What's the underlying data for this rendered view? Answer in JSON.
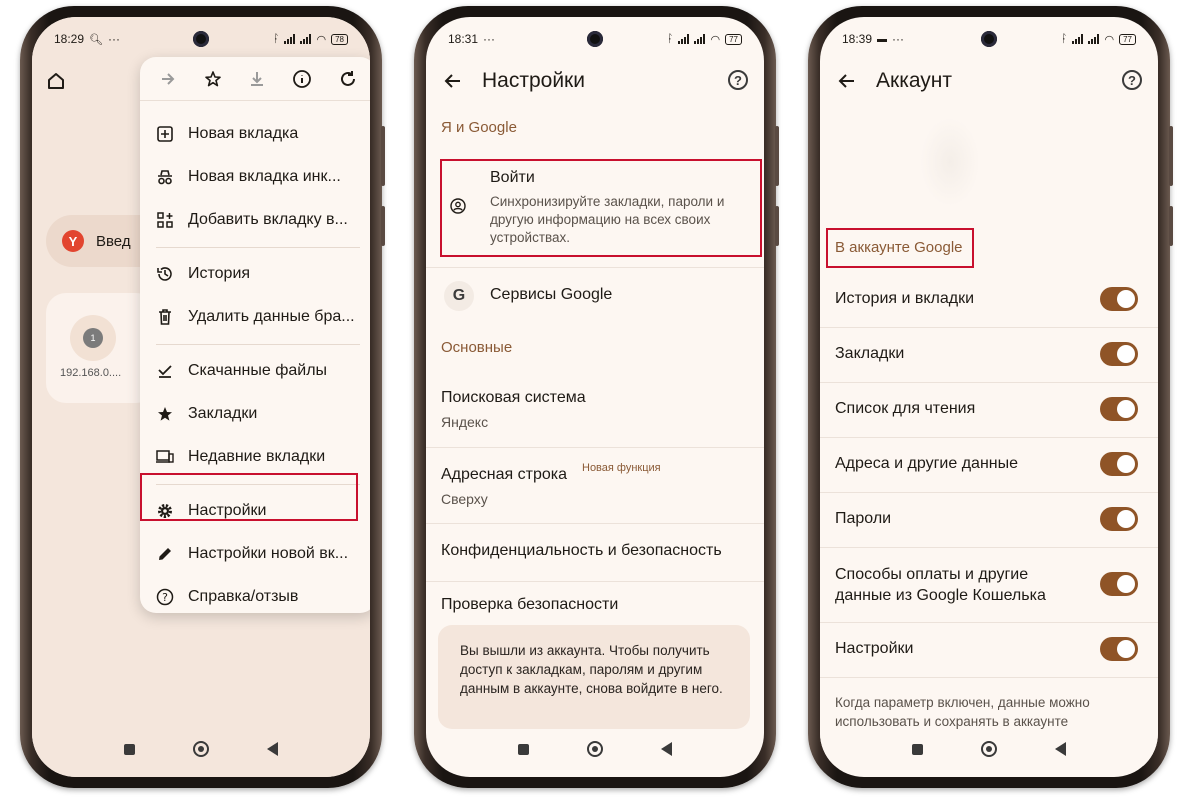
{
  "phone1": {
    "status": {
      "time": "18:29",
      "dots": "···",
      "battery": "78"
    },
    "toolbar_icons": [
      "arrow-forward-icon",
      "star-icon",
      "download-icon",
      "info-icon",
      "refresh-icon"
    ],
    "search_partial": "Введ",
    "tile_label": "192.168.0....",
    "tile_count": "1",
    "menu_items": [
      {
        "label": "Новая вкладка",
        "icon": "new-tab-icon"
      },
      {
        "label": "Новая вкладка инк...",
        "icon": "incognito-icon"
      },
      {
        "label": "Добавить вкладку в...",
        "icon": "add-to-group-icon"
      },
      {
        "label": "История",
        "icon": "history-icon"
      },
      {
        "label": "Удалить данные бра...",
        "icon": "trash-icon"
      },
      {
        "label": "Скачанные файлы",
        "icon": "downloads-icon"
      },
      {
        "label": "Закладки",
        "icon": "bookmark-star-icon"
      },
      {
        "label": "Недавние вкладки",
        "icon": "devices-icon"
      },
      {
        "label": "Настройки",
        "icon": "gear-icon"
      },
      {
        "label": "Настройки новой вк...",
        "icon": "pencil-icon"
      },
      {
        "label": "Справка/отзыв",
        "icon": "help-icon"
      }
    ]
  },
  "phone2": {
    "status": {
      "time": "18:31",
      "dots": "···",
      "battery": "77"
    },
    "title": "Настройки",
    "help_glyph": "?",
    "section_me": "Я и Google",
    "signin": {
      "title": "Войти",
      "subtitle": "Синхронизируйте закладки, пароли и другую информацию на всех своих устройствах."
    },
    "google_services": "Сервисы Google",
    "section_basic": "Основные",
    "search_engine": {
      "title": "Поисковая система",
      "value": "Яндекс"
    },
    "address_bar": {
      "title": "Адресная строка",
      "badge": "Новая функция",
      "value": "Сверху"
    },
    "privacy": "Конфиденциальность и безопасность",
    "safety_check": "Проверка безопасности",
    "signed_out_card": "Вы вышли из аккаунта. Чтобы получить доступ к закладкам, паролям и другим данным в аккаунте, снова войдите в него."
  },
  "phone3": {
    "status": {
      "time": "18:39",
      "dots": "···",
      "battery": "77"
    },
    "title": "Аккаунт",
    "help_glyph": "?",
    "section": "В аккаунте Google",
    "toggles": [
      {
        "label": "История и вкладки",
        "on": true
      },
      {
        "label": "Закладки",
        "on": true
      },
      {
        "label": "Список для чтения",
        "on": true
      },
      {
        "label": "Адреса и другие данные",
        "on": true
      },
      {
        "label": "Пароли",
        "on": true
      },
      {
        "label": "Способы оплаты и другие данные из Google Кошелька",
        "on": true
      },
      {
        "label": "Настройки",
        "on": true
      }
    ],
    "footer_note": "Когда параметр включен, данные можно использовать и сохранять в аккаунте"
  },
  "colors": {
    "highlight": "#c8102e",
    "accent": "#8a5a36",
    "toggle_on": "#8f5427"
  }
}
